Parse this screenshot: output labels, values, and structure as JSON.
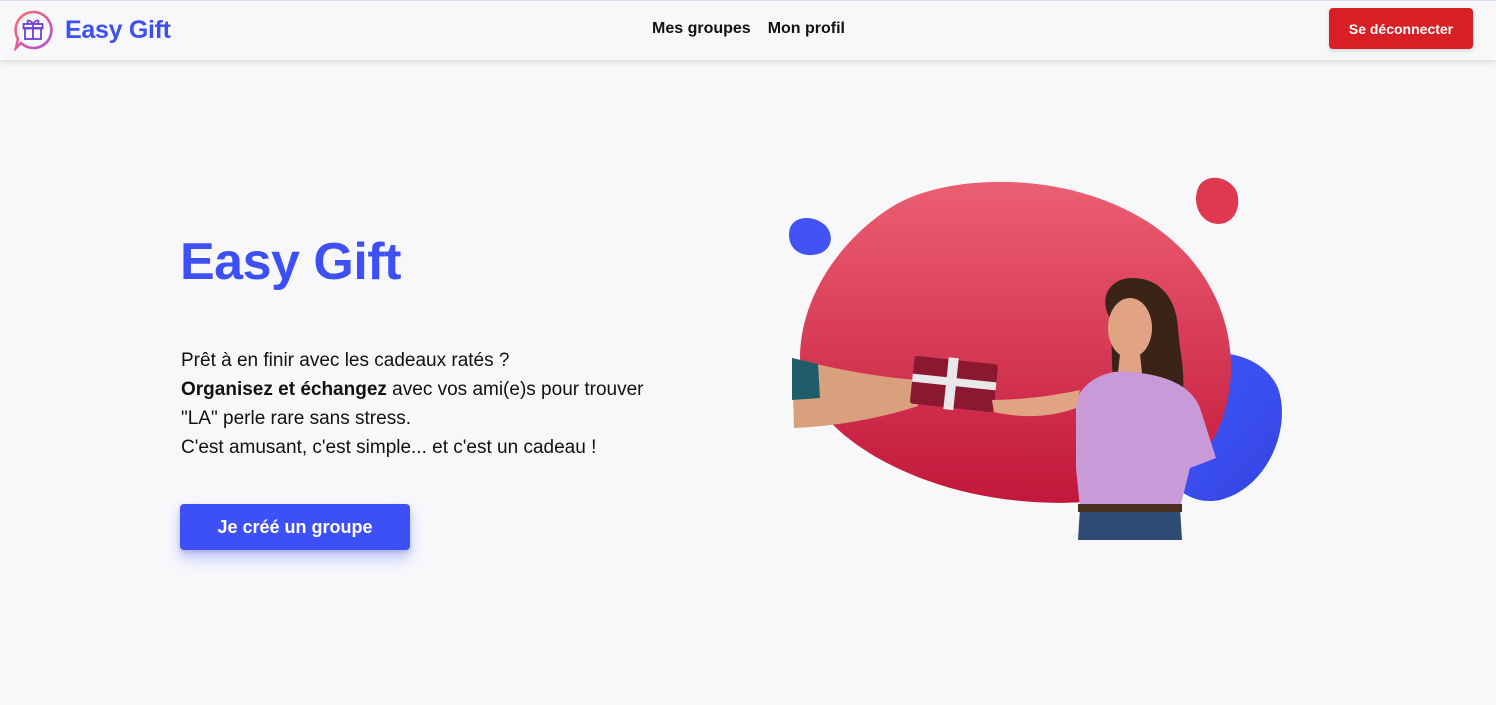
{
  "header": {
    "brand_name": "Easy Gift",
    "logo_icon": "gift-bubble-icon",
    "nav": [
      {
        "label": "Mes groupes"
      },
      {
        "label": "Mon profil"
      }
    ],
    "logout_label": "Se déconnecter"
  },
  "hero": {
    "title": "Easy Gift",
    "line1": "Prêt à en finir avec les cadeaux ratés ?",
    "line2_strong": "Organisez et échangez",
    "line2_rest": " avec vos ami(e)s pour trouver",
    "line3": "\"LA\" perle rare sans stress.",
    "line4": "C'est amusant, c'est simple... et c'est un cadeau !",
    "cta_label": "Je créé un groupe",
    "illustration": "woman-receiving-gift-illustration"
  },
  "colors": {
    "primary": "#3d50f5",
    "danger": "#d81f26",
    "blob_red": "#e0384f",
    "background": "#f8f8fb"
  }
}
